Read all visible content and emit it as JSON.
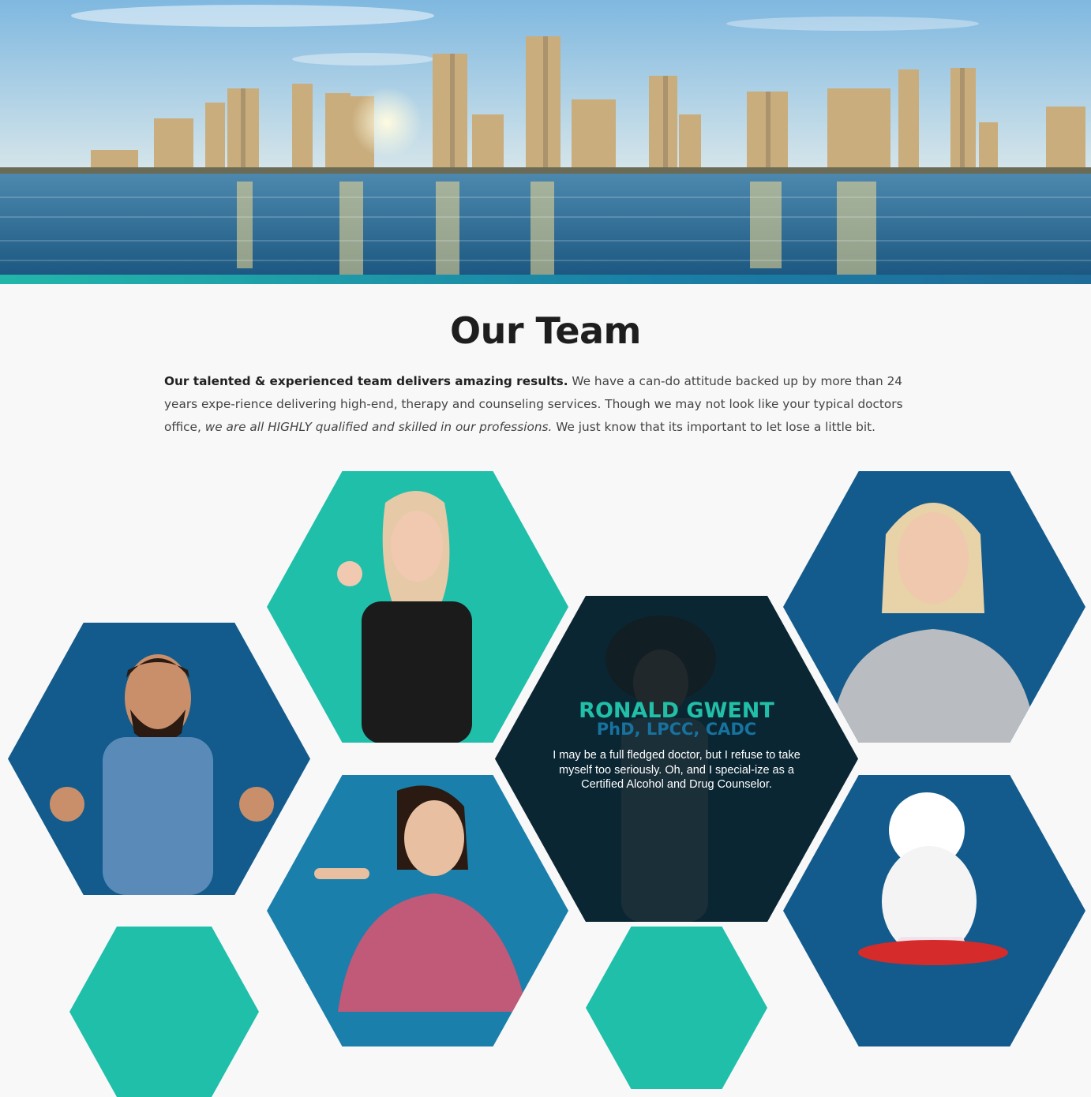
{
  "hero": {
    "alt": "San Diego skyline over the bay"
  },
  "section": {
    "title": "Our Team",
    "intro_bold": "Our talented & experienced team delivers amazing results.",
    "intro_p1": " We have a can-do attitude backed up by more than 24 years expe-rience delivering high-end, therapy and counseling services. Though we may not look like your typical doctors office, ",
    "intro_italic": "we are all HIGHLY qualified and skilled in our professions.",
    "intro_p2": " We just know that its important to let lose a little bit."
  },
  "featured": {
    "name": "RONALD GWENT",
    "credentials": "PhD, LPCC, CADC",
    "bio": "I may be a full fledged doctor, but I refuse to take myself too seriously. Oh, and I special-ize as a Certified Alcohol and Drug Counselor."
  },
  "colors": {
    "teal": "#1fbfaa",
    "navy": "#135b8c",
    "blue": "#1a7fab",
    "dark": "#0b2733",
    "name": "#22bfa8",
    "cred": "#17729e"
  }
}
